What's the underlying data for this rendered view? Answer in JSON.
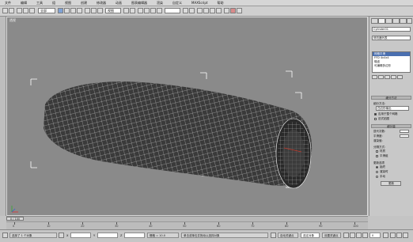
{
  "menu": [
    "文件",
    "编辑",
    "工具",
    "组",
    "视图",
    "创建",
    "修改器",
    "动画",
    "图表编辑器",
    "渲染",
    "自定义",
    "MAXScript",
    "帮助"
  ],
  "toolbar": {
    "selection_filter": "全部",
    "view_dropdown": "视图"
  },
  "viewport": {
    "label": "透视"
  },
  "panel": {
    "object_name": "Cylinder01",
    "modifier_list": "修改器列表",
    "stack": [
      "网格平滑",
      "FFD 4x4x4",
      "噪波",
      "可编辑多边形"
    ],
    "rollout1": "细分方法",
    "label_method": "细分方法:",
    "value_method": "四边形输出",
    "check1": "应用于整个网格",
    "check2": "旧式贴图",
    "rollout2": "细分量",
    "label_iter": "迭代次数:",
    "label_smooth": "平滑度:",
    "label_render": "渲染值:",
    "label_sep": "分隔方式:",
    "check3": "材质",
    "check4": "平滑组",
    "label_update": "更新选项",
    "radio1": "始终",
    "radio2": "渲染时",
    "radio3": "手动",
    "update_button": "更新"
  },
  "timeslider": {
    "frame": "0 / 100"
  },
  "ruler_labels": [
    "0",
    "10",
    "20",
    "30",
    "40",
    "50",
    "60",
    "70",
    "80",
    "90",
    "100"
  ],
  "statusbar": {
    "selected": "选择了 1 个对象",
    "prompt": "单击或单击并拖动以选择对象",
    "x": "X",
    "y": "Y",
    "z": "Z",
    "grid": "栅格 = 10.0",
    "autokey": "自动关键点",
    "setkey": "设置关键点",
    "selected_set": "选定对象",
    "frame": "0"
  },
  "colors": {
    "viewport_bg": "#8a8a8a",
    "mesh_wire": "#ffffff",
    "mesh_fill": "#3a3a3a",
    "selection_blue": "#4a6fb0"
  }
}
